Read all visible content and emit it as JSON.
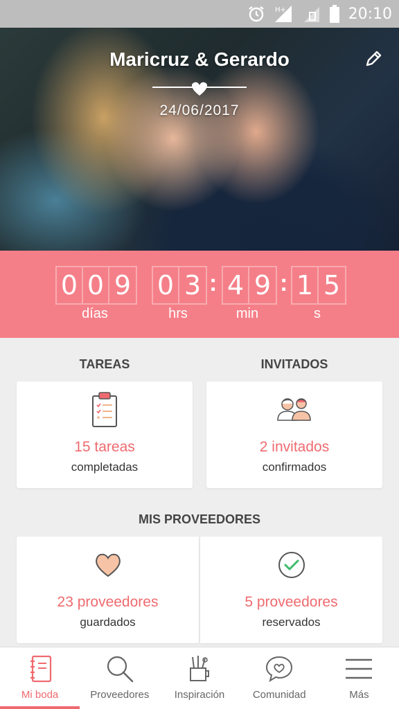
{
  "status_bar": {
    "time": "20:10",
    "icons": [
      "alarm-icon",
      "signal-h-plus-icon",
      "signal-no-sim-icon",
      "battery-icon"
    ],
    "network_label": "H+"
  },
  "hero": {
    "couple_names": "Maricruz & Gerardo",
    "wedding_date": "24/06/2017",
    "edit_icon": "pencil-icon"
  },
  "countdown": {
    "days": [
      "0",
      "0",
      "9"
    ],
    "hours": [
      "0",
      "3"
    ],
    "minutes": [
      "4",
      "9"
    ],
    "seconds": [
      "1",
      "5"
    ],
    "labels": {
      "days": "días",
      "hours": "hrs",
      "minutes": "min",
      "seconds": "s"
    },
    "background_color": "#f57f88"
  },
  "sections": {
    "tasks": {
      "title": "TAREAS",
      "count": "15 tareas",
      "subtitle": "completadas",
      "icon": "clipboard-checklist-icon"
    },
    "guests": {
      "title": "INVITADOS",
      "count": "2 invitados",
      "subtitle": "confirmados",
      "icon": "guests-couple-icon"
    },
    "vendors": {
      "title": "MIS PROVEEDORES",
      "saved": {
        "count": "23 proveedores",
        "subtitle": "guardados",
        "icon": "heart-icon"
      },
      "booked": {
        "count": "5 proveedores",
        "subtitle": "reservados",
        "icon": "check-circle-icon"
      }
    }
  },
  "bottom_nav": {
    "items": [
      {
        "label": "Mi boda",
        "icon": "notebook-icon",
        "active": true
      },
      {
        "label": "Proveedores",
        "icon": "search-icon",
        "active": false
      },
      {
        "label": "Inspiración",
        "icon": "pencil-cup-icon",
        "active": false
      },
      {
        "label": "Comunidad",
        "icon": "chat-heart-icon",
        "active": false
      },
      {
        "label": "Más",
        "icon": "menu-icon",
        "active": false
      }
    ]
  },
  "colors": {
    "accent": "#ef6a6f",
    "status_bar": "#bdbdbd",
    "background": "#eeeeee"
  }
}
